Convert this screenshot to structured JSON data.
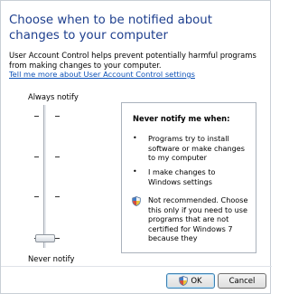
{
  "dialog": {
    "title": "Choose when to be notified about changes to your computer",
    "description": "User Account Control helps prevent potentially harmful programs from making changes to your computer.",
    "learn_more_link": "Tell me more about User Account Control settings"
  },
  "slider": {
    "top_label": "Always notify",
    "bottom_label": "Never notify",
    "levels": 4,
    "selected_level": 1
  },
  "info": {
    "heading": "Never notify me when:",
    "bullet_1": "Programs try to install software or make changes to my computer",
    "bullet_2": "I make changes to Windows settings",
    "warning": "Not recommended. Choose this only if you need to use programs that are not certified for Windows 7 because they",
    "bullet_glyph": "•"
  },
  "buttons": {
    "ok": "OK",
    "cancel": "Cancel"
  },
  "colors": {
    "title": "#1e3f8e",
    "link": "#0b50b7"
  },
  "icons": {
    "warning": "shield-icon",
    "ok_button": "shield-icon"
  }
}
